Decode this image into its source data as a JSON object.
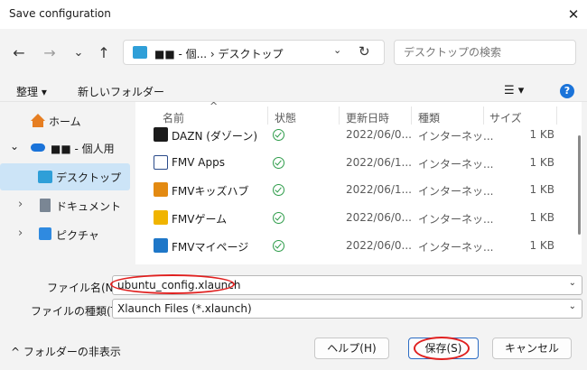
{
  "window": {
    "title": "Save configuration",
    "close": "✕"
  },
  "nav": {
    "back": "←",
    "forward": "→",
    "dropdown": "⌄",
    "up": "↑"
  },
  "address": {
    "path": "■■ - 個...  ›  デスクトップ",
    "sep": "›",
    "drop": "⌄",
    "refresh": "↻"
  },
  "search": {
    "placeholder": "デスクトップの検索"
  },
  "toolbar": {
    "organize": "整理 ▾",
    "new_folder": "新しいフォルダー",
    "view": "☰ ▾",
    "help": "?"
  },
  "sidebar": {
    "items": [
      {
        "label": "ホーム",
        "chev": ""
      },
      {
        "label": "■■ - 個人用",
        "chev": "⌄"
      },
      {
        "label": "デスクトップ",
        "chev": ""
      },
      {
        "label": "ドキュメント",
        "chev": "›"
      },
      {
        "label": "ピクチャ",
        "chev": "›"
      }
    ]
  },
  "columns": {
    "name": "名前",
    "status": "状態",
    "date": "更新日時",
    "type": "種類",
    "size": "サイズ",
    "sort": "^"
  },
  "files": [
    {
      "name": "DAZN (ダゾーン)",
      "date": "2022/06/0...",
      "type": "インターネッ...",
      "size": "1 KB",
      "color": "#1b1b1b"
    },
    {
      "name": "FMV Apps",
      "date": "2022/06/1...",
      "type": "インターネッ...",
      "size": "1 KB",
      "color": "#2a4b8a"
    },
    {
      "name": "FMVキッズハブ",
      "date": "2022/06/1...",
      "type": "インターネッ...",
      "size": "1 KB",
      "color": "#e38a12"
    },
    {
      "name": "FMVゲーム",
      "date": "2022/06/0...",
      "type": "インターネッ...",
      "size": "1 KB",
      "color": "#f0b400"
    },
    {
      "name": "FMVマイページ",
      "date": "2022/06/0...",
      "type": "インターネッ...",
      "size": "1 KB",
      "color": "#1f77c8"
    }
  ],
  "filename": {
    "label": "ファイル名(N):",
    "value": "ubuntu_config.xlaunch"
  },
  "filetype": {
    "label": "ファイルの種類(T):",
    "value": "Xlaunch Files (*.xlaunch)"
  },
  "footer": {
    "hide_folders": "^  フォルダーの非表示",
    "help_btn": "ヘルプ(H)",
    "save_btn": "保存(S)",
    "cancel_btn": "キャンセル"
  }
}
